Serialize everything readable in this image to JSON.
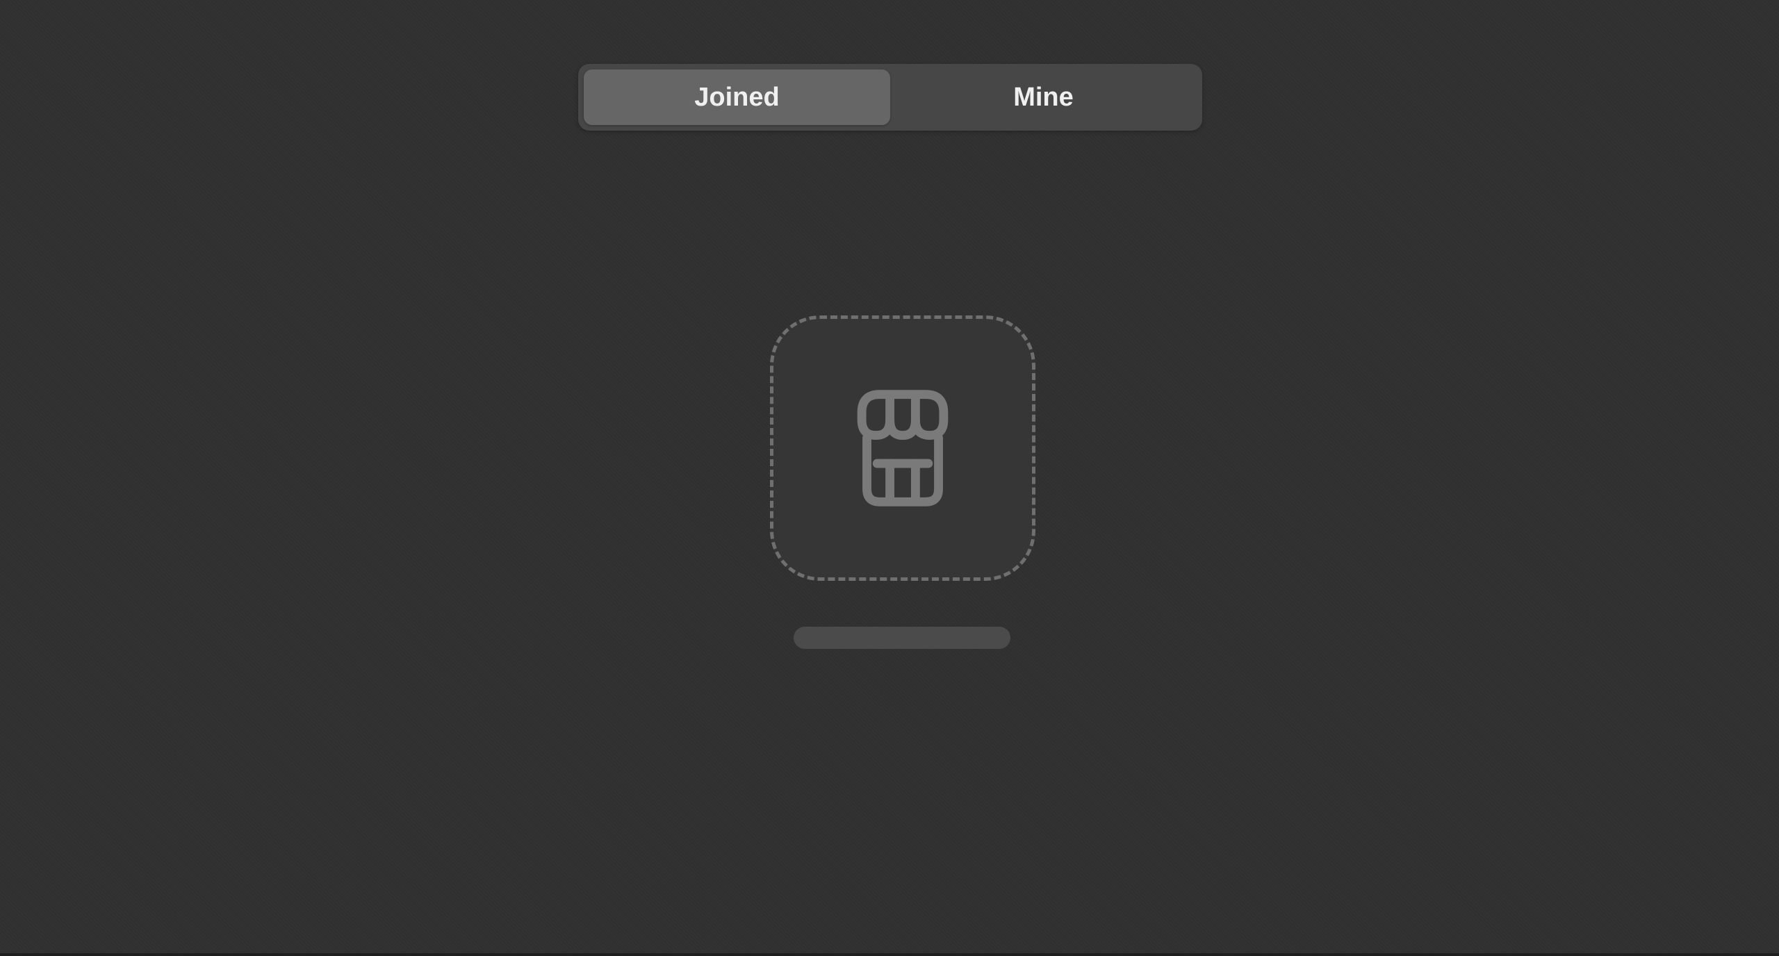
{
  "segmented_control": {
    "items": [
      {
        "label": "Joined",
        "selected": true
      },
      {
        "label": "Mine",
        "selected": false
      }
    ]
  },
  "empty_state": {
    "icon": "storefront-icon"
  },
  "colors": {
    "background": "#303030",
    "segment_track": "#474747",
    "segment_selected": "#666666",
    "icon_stroke": "#7a7a7a",
    "dashed_border": "#6f6f6f"
  }
}
